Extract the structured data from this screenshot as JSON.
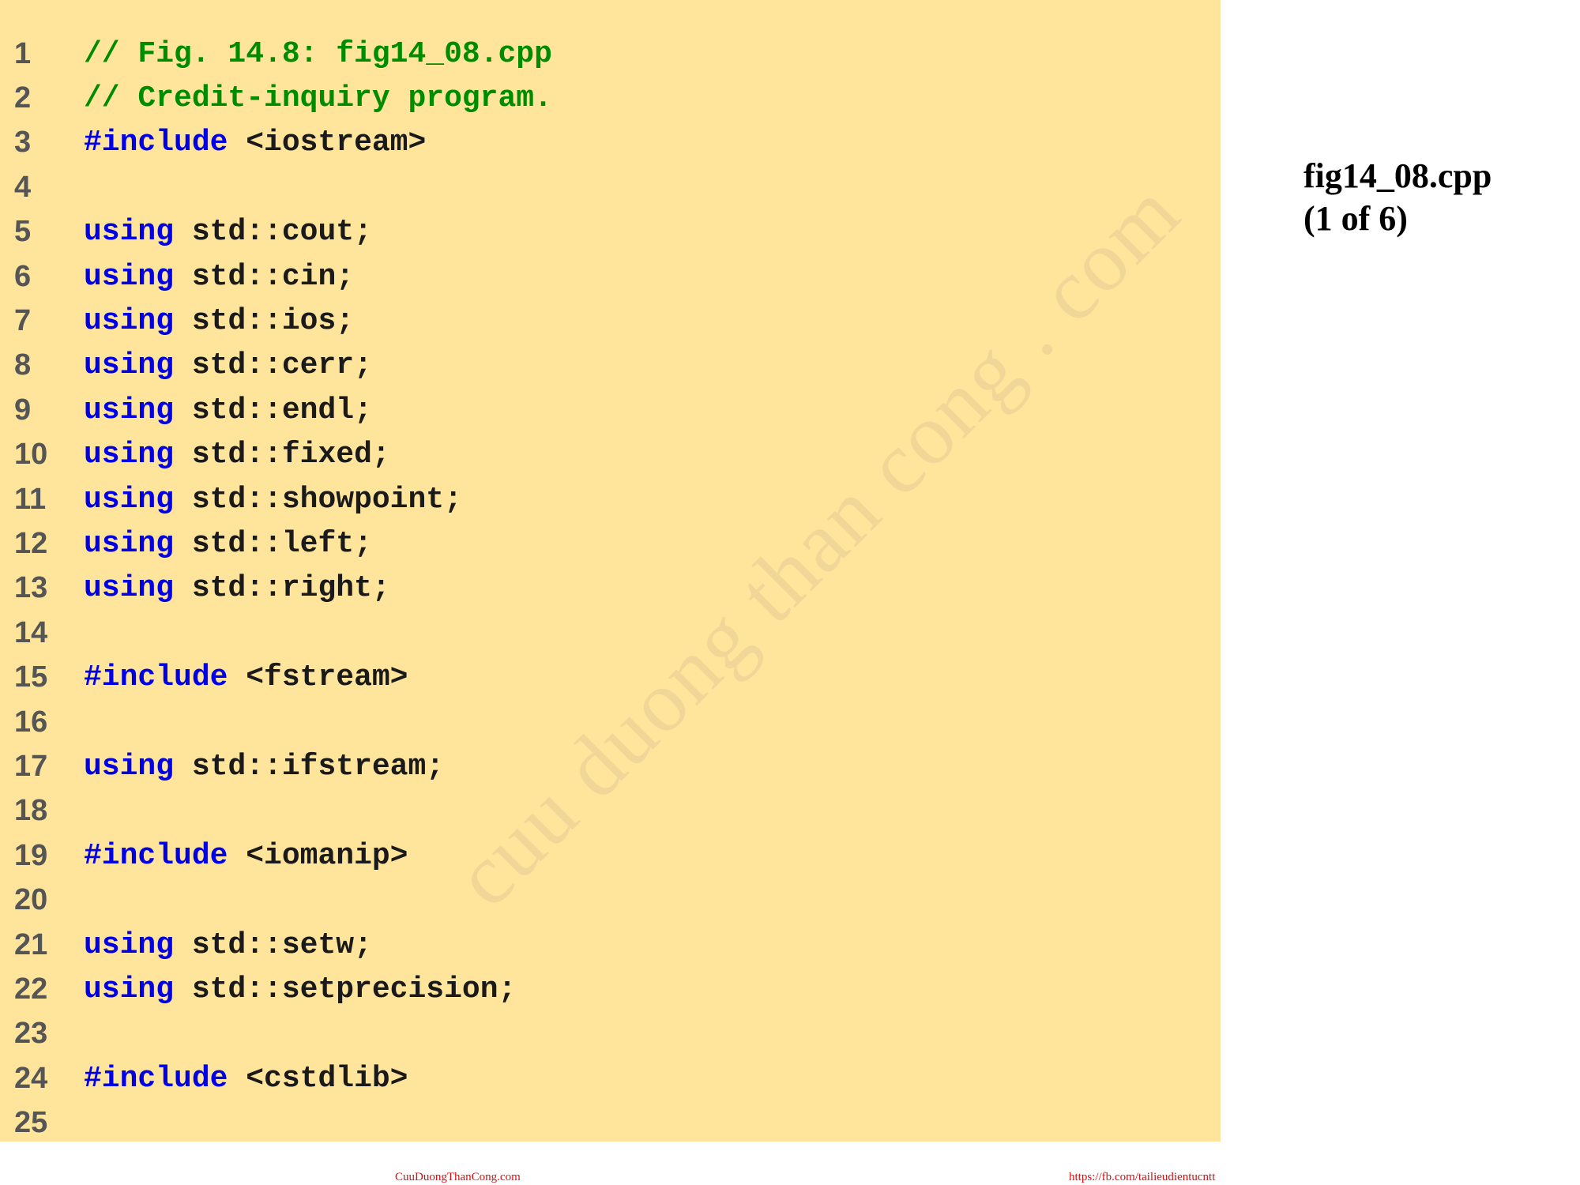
{
  "slide": {
    "title": "fig14_08.cpp",
    "subtitle": "(1 of 6)",
    "watermark": "cuu duong than cong . com"
  },
  "code": {
    "lines": [
      {
        "num": "1",
        "tokens": [
          {
            "type": "comment",
            "text": "// Fig. 14.8: fig14_08.cpp"
          }
        ]
      },
      {
        "num": "2",
        "tokens": [
          {
            "type": "comment",
            "text": "// Credit-inquiry program."
          }
        ]
      },
      {
        "num": "3",
        "tokens": [
          {
            "type": "keyword",
            "text": "#include"
          },
          {
            "type": "plain",
            "text": " <iostream>"
          }
        ]
      },
      {
        "num": "4",
        "tokens": []
      },
      {
        "num": "5",
        "tokens": [
          {
            "type": "keyword",
            "text": "using"
          },
          {
            "type": "plain",
            "text": " std::cout;"
          }
        ]
      },
      {
        "num": "6",
        "tokens": [
          {
            "type": "keyword",
            "text": "using"
          },
          {
            "type": "plain",
            "text": " std::cin;"
          }
        ]
      },
      {
        "num": "7",
        "tokens": [
          {
            "type": "keyword",
            "text": "using"
          },
          {
            "type": "plain",
            "text": " std::ios;"
          }
        ]
      },
      {
        "num": "8",
        "tokens": [
          {
            "type": "keyword",
            "text": "using"
          },
          {
            "type": "plain",
            "text": " std::cerr;"
          }
        ]
      },
      {
        "num": "9",
        "tokens": [
          {
            "type": "keyword",
            "text": "using"
          },
          {
            "type": "plain",
            "text": " std::endl;"
          }
        ]
      },
      {
        "num": "10",
        "tokens": [
          {
            "type": "keyword",
            "text": "using"
          },
          {
            "type": "plain",
            "text": " std::fixed;"
          }
        ]
      },
      {
        "num": "11",
        "tokens": [
          {
            "type": "keyword",
            "text": "using"
          },
          {
            "type": "plain",
            "text": " std::showpoint;"
          }
        ]
      },
      {
        "num": "12",
        "tokens": [
          {
            "type": "keyword",
            "text": "using"
          },
          {
            "type": "plain",
            "text": " std::left;"
          }
        ]
      },
      {
        "num": "13",
        "tokens": [
          {
            "type": "keyword",
            "text": "using"
          },
          {
            "type": "plain",
            "text": " std::right;"
          }
        ]
      },
      {
        "num": "14",
        "tokens": []
      },
      {
        "num": "15",
        "tokens": [
          {
            "type": "keyword",
            "text": "#include"
          },
          {
            "type": "plain",
            "text": " <fstream>"
          }
        ]
      },
      {
        "num": "16",
        "tokens": []
      },
      {
        "num": "17",
        "tokens": [
          {
            "type": "keyword",
            "text": "using"
          },
          {
            "type": "plain",
            "text": " std::ifstream;"
          }
        ]
      },
      {
        "num": "18",
        "tokens": []
      },
      {
        "num": "19",
        "tokens": [
          {
            "type": "keyword",
            "text": "#include"
          },
          {
            "type": "plain",
            "text": " <iomanip>"
          }
        ]
      },
      {
        "num": "20",
        "tokens": []
      },
      {
        "num": "21",
        "tokens": [
          {
            "type": "keyword",
            "text": "using"
          },
          {
            "type": "plain",
            "text": " std::setw;"
          }
        ]
      },
      {
        "num": "22",
        "tokens": [
          {
            "type": "keyword",
            "text": "using"
          },
          {
            "type": "plain",
            "text": " std::setprecision;"
          }
        ]
      },
      {
        "num": "23",
        "tokens": []
      },
      {
        "num": "24",
        "tokens": [
          {
            "type": "keyword",
            "text": "#include"
          },
          {
            "type": "plain",
            "text": " <cstdlib>"
          }
        ]
      },
      {
        "num": "25",
        "tokens": []
      }
    ]
  },
  "footer": {
    "left_link": "CuuDuongThanCong.com",
    "right_link": "https://fb.com/tailieudientucntt"
  },
  "colors": {
    "panel_background": "#ffe49c",
    "comment": "#008c00",
    "keyword": "#0000e6",
    "code_text": "#1a1a1a",
    "line_number": "#555555",
    "footer_link": "#d41010"
  }
}
